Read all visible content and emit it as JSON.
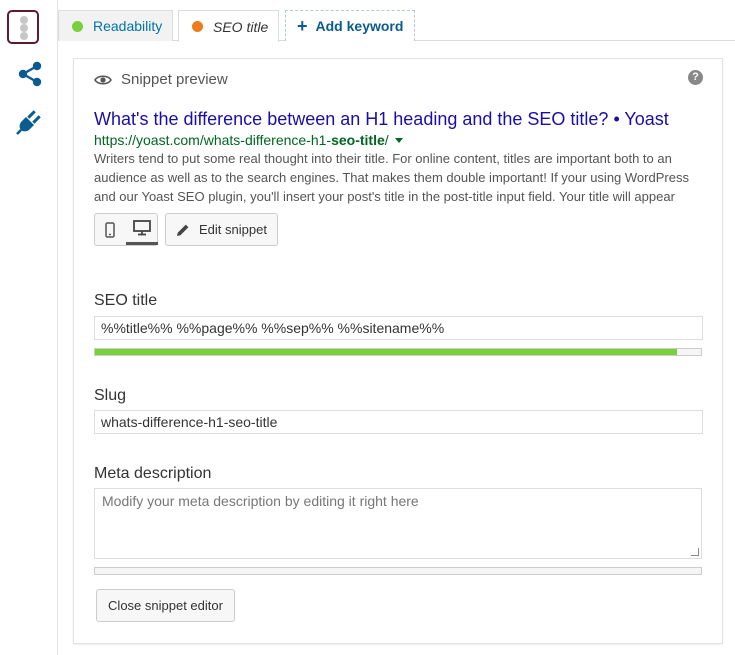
{
  "tabs": {
    "readability": {
      "label": "Readability",
      "status_color": "#7ad03a"
    },
    "seo_title": {
      "label": "SEO title",
      "status_color": "#ee7c1b"
    },
    "add_keyword": {
      "label": "Add keyword",
      "icon": "plus-icon"
    }
  },
  "rail": {
    "icons": [
      "traffic-light-icon",
      "share-icon",
      "plug-icon"
    ]
  },
  "snippet_preview": {
    "heading": "Snippet preview",
    "help_glyph": "?",
    "title": "What's the difference between an H1 heading and the SEO title? • Yoast",
    "url_prefix": "https://yoast.com/whats-difference-h1-",
    "url_bold": "seo-title",
    "url_suffix": "/",
    "description": "Writers tend to put some real thought into their title. For online content, titles are important both to an audience as well as to the search engines. That makes them double important! If your using WordPress and our Yoast SEO plugin, you'll insert your post's title in the post-title input field. Your title will appear",
    "edit_button": "Edit snippet",
    "active_mode": "desktop"
  },
  "editor": {
    "seo_title_label": "SEO title",
    "seo_title_value": "%%title%% %%page%% %%sep%% %%sitename%%",
    "seo_title_progress": 0.96,
    "slug_label": "Slug",
    "slug_value": "whats-difference-h1-seo-title",
    "meta_label": "Meta description",
    "meta_placeholder": "Modify your meta description by editing it right here",
    "meta_progress": 0,
    "close_button": "Close snippet editor"
  },
  "colors": {
    "accent": "#0073aa",
    "progress_good": "#7ad03a",
    "serp_title": "#1a0dab",
    "serp_url": "#006621"
  }
}
